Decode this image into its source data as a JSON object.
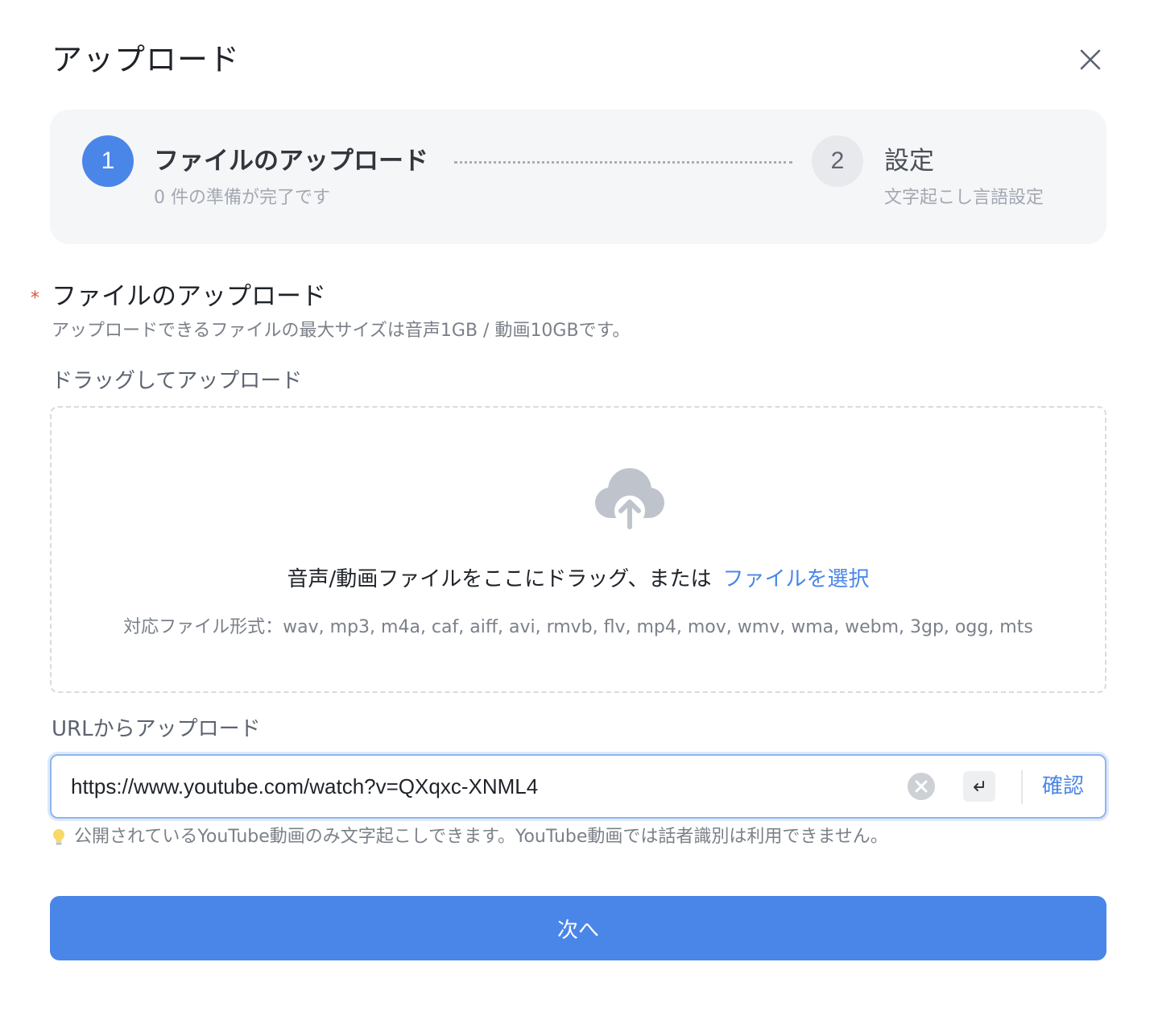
{
  "dialog": {
    "title": "アップロード"
  },
  "steps": [
    {
      "number": "1",
      "title": "ファイルのアップロード",
      "subtitle": "0 件の準備が完了です",
      "active": true
    },
    {
      "number": "2",
      "title": "設定",
      "subtitle": "文字起こし言語設定",
      "active": false
    }
  ],
  "upload": {
    "required_mark": "*",
    "title": "ファイルのアップロード",
    "description": "アップロードできるファイルの最大サイズは音声1GB / 動画10GBです。",
    "drag_label": "ドラッグしてアップロード",
    "drop_text": "音声/動画ファイルをここにドラッグ、または",
    "select_link": "ファイルを選択",
    "formats": "対応ファイル形式：wav, mp3, m4a, caf, aiff, avi, rmvb, flv, mp4, mov, wmv, wma, webm, 3gp, ogg, mts"
  },
  "url": {
    "label": "URLからアップロード",
    "value": "https://www.youtube.com/watch?v=QXqxc-XNML4",
    "confirm_label": "確認",
    "hint": "公開されているYouTube動画のみ文字起こしできます。YouTube動画では話者識別は利用できません。"
  },
  "footer": {
    "next_label": "次へ"
  },
  "colors": {
    "accent": "#4a86e8",
    "required": "#e2513f"
  }
}
